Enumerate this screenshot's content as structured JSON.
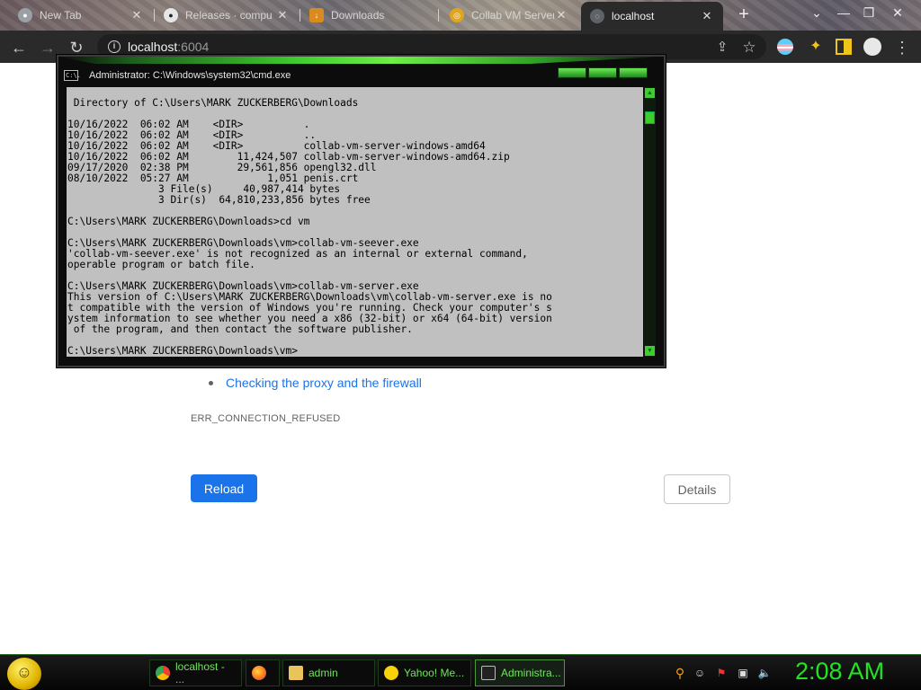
{
  "browser": {
    "tabs": [
      {
        "title": "New Tab",
        "icon": "chrome-icon"
      },
      {
        "title": "Releases · compu",
        "icon": "github-icon"
      },
      {
        "title": "Downloads",
        "icon": "download-icon"
      },
      {
        "title": "Collab VM Server",
        "icon": "collabvm-icon"
      },
      {
        "title": "localhost",
        "icon": "page-icon",
        "active": true
      }
    ],
    "new_tab_glyph": "+",
    "window_controls": {
      "chevron": "⌄",
      "minimize": "—",
      "maximize": "❐",
      "close": "✕"
    },
    "close_glyph": "✕"
  },
  "toolbar": {
    "back": "←",
    "forward": "→",
    "reload": "↻",
    "url_host": "localhost",
    "url_port": ":6004",
    "share": "⇪",
    "star": "☆",
    "menu": "⋮"
  },
  "error_page": {
    "suggestion": "Checking the proxy and the firewall",
    "error_code": "ERR_CONNECTION_REFUSED",
    "reload_label": "Reload",
    "details_label": "Details"
  },
  "cmd": {
    "title": "Administrator: C:\\Windows\\system32\\cmd.exe",
    "icon_text": "C:\\.",
    "lines": [
      " Directory of C:\\Users\\MARK ZUCKERBERG\\Downloads",
      "",
      "10/16/2022  06:02 AM    <DIR>          .",
      "10/16/2022  06:02 AM    <DIR>          ..",
      "10/16/2022  06:02 AM    <DIR>          collab-vm-server-windows-amd64",
      "10/16/2022  06:02 AM        11,424,507 collab-vm-server-windows-amd64.zip",
      "09/17/2020  02:38 PM        29,561,856 opengl32.dll",
      "08/10/2022  05:27 AM             1,051 penis.crt",
      "               3 File(s)     40,987,414 bytes",
      "               3 Dir(s)  64,810,233,856 bytes free",
      "",
      "C:\\Users\\MARK ZUCKERBERG\\Downloads>cd vm",
      "",
      "C:\\Users\\MARK ZUCKERBERG\\Downloads\\vm>collab-vm-seever.exe",
      "'collab-vm-seever.exe' is not recognized as an internal or external command,",
      "operable program or batch file.",
      "",
      "C:\\Users\\MARK ZUCKERBERG\\Downloads\\vm>collab-vm-server.exe",
      "This version of C:\\Users\\MARK ZUCKERBERG\\Downloads\\vm\\collab-vm-server.exe is no",
      "t compatible with the version of Windows you're running. Check your computer's s",
      "ystem information to see whether you need a x86 (32-bit) or x64 (64-bit) version",
      " of the program, and then contact the software publisher.",
      "",
      "C:\\Users\\MARK ZUCKERBERG\\Downloads\\vm>"
    ]
  },
  "taskbar": {
    "tasks": [
      {
        "label": "localhost - ...",
        "icon": "chrome-icon",
        "color": "#4285f4"
      },
      {
        "label": "",
        "icon": "firefox-icon",
        "color": "#ff7a18"
      },
      {
        "label": "admin",
        "icon": "folder-icon",
        "color": "#e8c45a"
      },
      {
        "label": "Yahoo! Me...",
        "icon": "yahoo-messenger-icon",
        "color": "#f5d20a"
      },
      {
        "label": "Administra...",
        "icon": "cmd-icon",
        "color": "#222222",
        "active": true
      }
    ],
    "clock": "2:08 AM"
  },
  "colors": {
    "chrome_toolbar": "#2a2a2a",
    "link_blue": "#1a73e8",
    "cmd_green": "#3ccf2c",
    "clock_green": "#23e223"
  }
}
